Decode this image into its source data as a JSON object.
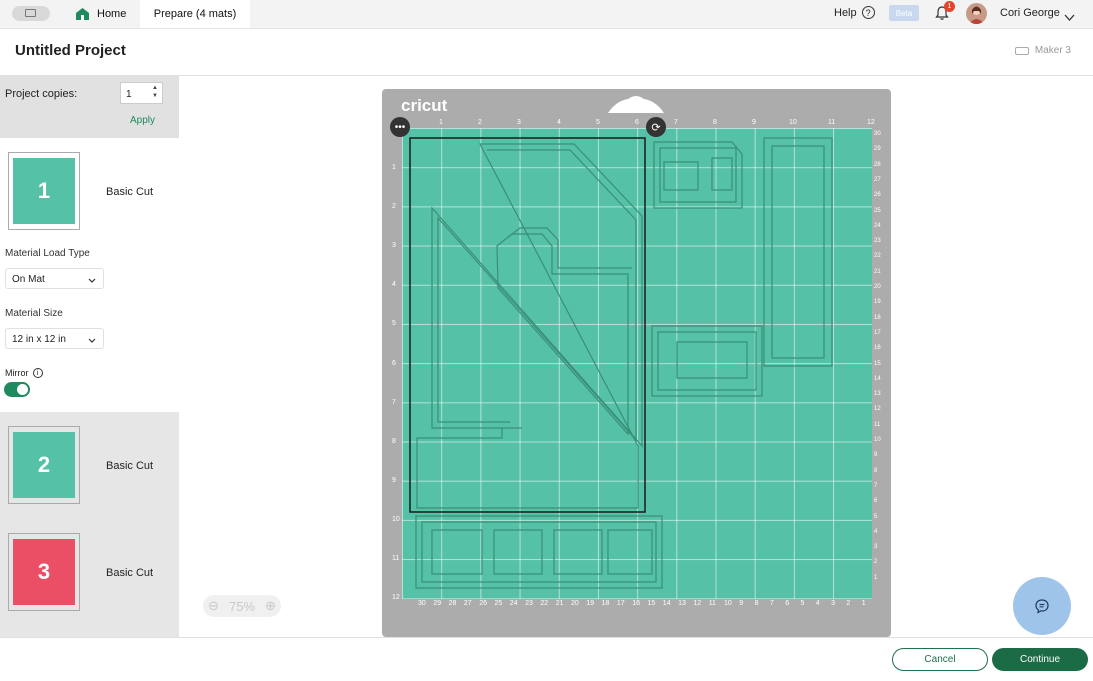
{
  "topbar": {
    "tabs": [
      {
        "label": "Home"
      },
      {
        "label": "Prepare (4 mats)"
      }
    ],
    "help_label": "Help",
    "help_icon": "?",
    "beta_label": "Beta",
    "notifications_count": "1",
    "user_name": "Cori George"
  },
  "project": {
    "title": "Untitled Project",
    "machine": "Maker 3"
  },
  "sidebar": {
    "copies_label": "Project copies:",
    "copies_value": "1",
    "apply_label": "Apply",
    "mats": [
      {
        "number": "1",
        "label": "Basic Cut",
        "color": "#55c1a6"
      },
      {
        "number": "2",
        "label": "Basic Cut",
        "color": "#55c1a6"
      },
      {
        "number": "3",
        "label": "Basic Cut",
        "color": "#ea4f66"
      }
    ],
    "load_type_label": "Material Load Type",
    "load_type_value": "On Mat",
    "size_label": "Material Size",
    "size_value": "12 in x 12 in",
    "mirror_label": "Mirror",
    "mirror_on": true
  },
  "mat": {
    "brand": "cricut",
    "top_ruler": [
      "1",
      "2",
      "3",
      "4",
      "5",
      "6",
      "7",
      "8",
      "9",
      "10",
      "11",
      "12"
    ],
    "left_ruler": [
      "1",
      "2",
      "3",
      "4",
      "5",
      "6",
      "7",
      "8",
      "9",
      "10",
      "11",
      "12"
    ],
    "bottom_ruler": [
      "30",
      "29",
      "28",
      "27",
      "26",
      "25",
      "24",
      "23",
      "22",
      "21",
      "20",
      "19",
      "18",
      "17",
      "16",
      "15",
      "14",
      "13",
      "12",
      "11",
      "10",
      "9",
      "8",
      "7",
      "6",
      "5",
      "4",
      "3",
      "2",
      "1"
    ],
    "right_ruler": [
      "30",
      "29",
      "28",
      "27",
      "26",
      "25",
      "24",
      "23",
      "22",
      "21",
      "20",
      "19",
      "18",
      "17",
      "16",
      "15",
      "14",
      "13",
      "12",
      "11",
      "10",
      "9",
      "8",
      "7",
      "6",
      "5",
      "4",
      "3",
      "2",
      "1"
    ],
    "grid_color": "#55c1a6"
  },
  "zoom": {
    "value": "75%"
  },
  "footer": {
    "cancel_label": "Cancel",
    "continue_label": "Continue"
  }
}
